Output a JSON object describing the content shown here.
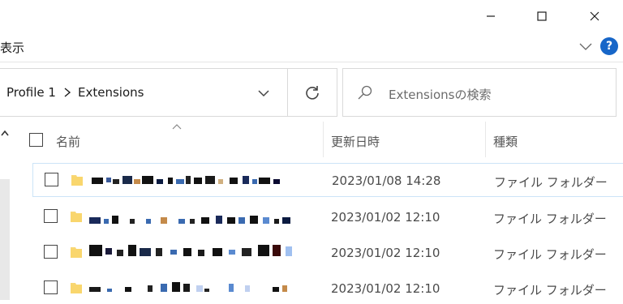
{
  "window": {
    "minimize_icon": "minimize-icon",
    "maximize_icon": "maximize-icon",
    "close_icon": "close-icon"
  },
  "ribbon": {
    "view_tab": "表示",
    "expand_icon": "chevron-down-icon",
    "help_label": "?"
  },
  "address": {
    "breadcrumbs": [
      "Profile 1",
      "Extensions"
    ],
    "separator_icon": "chevron-right-icon",
    "dropdown_icon": "chevron-down-icon",
    "refresh_icon": "refresh-icon"
  },
  "search": {
    "placeholder": "Extensionsの検索",
    "icon": "search-icon"
  },
  "columns": {
    "name": "名前",
    "date": "更新日時",
    "type": "種類"
  },
  "accent": "#1766c8",
  "rows": [
    {
      "date": "2023/01/08 14:28",
      "type": "ファイル フォルダー",
      "selected": true
    },
    {
      "date": "2023/01/02 12:10",
      "type": "ファイル フォルダー",
      "selected": false
    },
    {
      "date": "2023/01/02 12:10",
      "type": "ファイル フォルダー",
      "selected": false
    },
    {
      "date": "2023/01/02 12:10",
      "type": "ファイル フォルダー",
      "selected": false
    }
  ]
}
